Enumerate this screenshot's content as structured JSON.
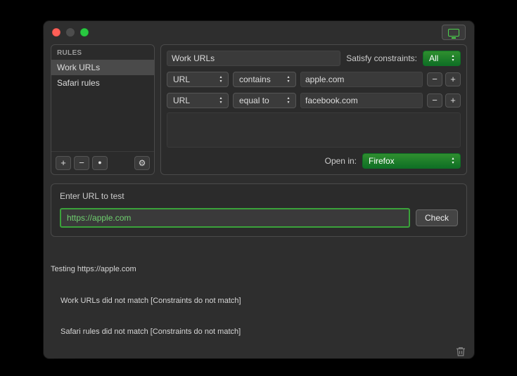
{
  "window": {
    "toolbar_icon": "monitor-icon"
  },
  "sidebar": {
    "header": "RULES",
    "items": [
      {
        "label": "Work URLs",
        "selected": true
      },
      {
        "label": "Safari rules",
        "selected": false
      }
    ]
  },
  "editor": {
    "name_value": "Work URLs",
    "satisfy_label": "Satisfy constraints:",
    "satisfy_value": "All",
    "constraints": [
      {
        "field": "URL",
        "operator": "contains",
        "value": "apple.com"
      },
      {
        "field": "URL",
        "operator": "equal to",
        "value": "facebook.com"
      }
    ],
    "open_in_label": "Open in:",
    "open_in_value": "Firefox"
  },
  "test": {
    "title": "Enter URL to test",
    "input_value": "https://apple.com",
    "button_label": "Check"
  },
  "log": {
    "line1": "Testing https://apple.com",
    "line2": "Work URLs did not match [Constraints do not match]",
    "line3": "Safari rules did not match [Constraints do not match]"
  },
  "glyphs": {
    "plus": "+",
    "minus": "−",
    "dot": "●",
    "gear": "⚙"
  }
}
